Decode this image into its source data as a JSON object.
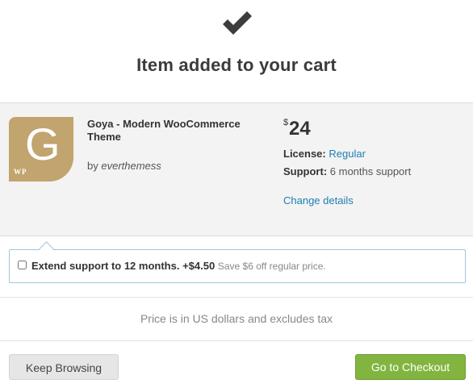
{
  "header": {
    "icon": "checkmark-icon",
    "title": "Item added to your cart"
  },
  "item": {
    "thumbnail": {
      "letter": "G",
      "badge": "WP",
      "color": "#c1a46e"
    },
    "name": "Goya - Modern WooCommerce Theme",
    "by_prefix": "by",
    "author": "everthemess",
    "price_currency": "$",
    "price": "24",
    "license_label": "License:",
    "license_value": "Regular",
    "support_label": "Support:",
    "support_value": "6 months support",
    "change_details": "Change details"
  },
  "extend_support": {
    "checked": false,
    "label": "Extend support to 12 months.",
    "price": "+$4.50",
    "note": "Save $6 off regular price."
  },
  "footer_note": "Price is in US dollars and excludes tax",
  "actions": {
    "keep_browsing": "Keep Browsing",
    "checkout": "Go to Checkout"
  },
  "colors": {
    "link": "#1d7fb0",
    "checkout_button": "#82b540",
    "panel_background": "#f3f3f3"
  }
}
